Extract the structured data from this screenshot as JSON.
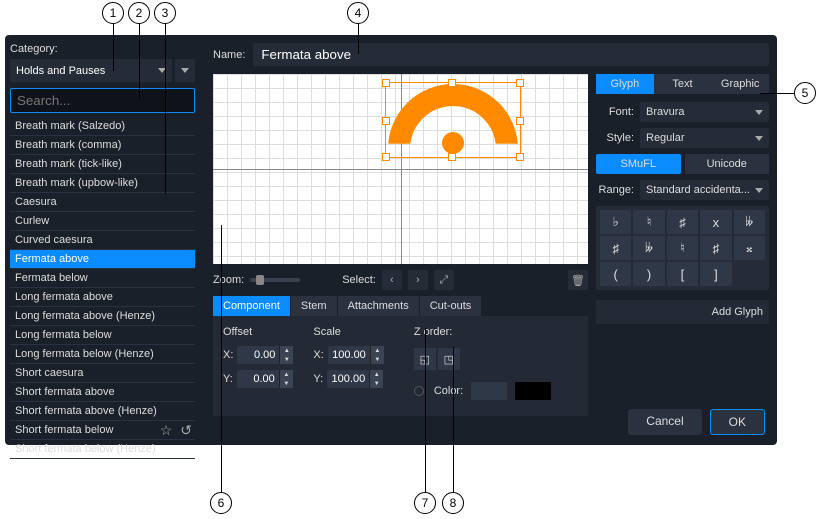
{
  "category": {
    "label": "Category:",
    "value": "Holds and Pauses"
  },
  "search": {
    "placeholder": "Search..."
  },
  "items": [
    "Breath mark (Salzedo)",
    "Breath mark (comma)",
    "Breath mark (tick-like)",
    "Breath mark (upbow-like)",
    "Caesura",
    "Curlew",
    "Curved caesura",
    "Fermata above",
    "Fermata below",
    "Long fermata above",
    "Long fermata above (Henze)",
    "Long fermata below",
    "Long fermata below (Henze)",
    "Short caesura",
    "Short fermata above",
    "Short fermata above (Henze)",
    "Short fermata below",
    "Short fermata below (Henze)"
  ],
  "selected": "Fermata above",
  "name": {
    "label": "Name:",
    "value": "Fermata above"
  },
  "zoom": {
    "label": "Zoom:"
  },
  "select": {
    "label": "Select:"
  },
  "tabs": [
    "Component",
    "Stem",
    "Attachments",
    "Cut-outs"
  ],
  "props": {
    "offset": {
      "label": "Offset",
      "x": "0.00",
      "y": "0.00"
    },
    "scale": {
      "label": "Scale",
      "x": "100.00",
      "y": "100.00"
    },
    "zorder": "Z order:",
    "color": "Color:",
    "xlabel": "X:",
    "ylabel": "Y:"
  },
  "side": {
    "tabs": [
      "Glyph",
      "Text",
      "Graphic"
    ],
    "font": {
      "label": "Font:",
      "value": "Bravura"
    },
    "style": {
      "label": "Style:",
      "value": "Regular"
    },
    "enc": [
      "SMuFL",
      "Unicode"
    ],
    "range": {
      "label": "Range:",
      "value": "Standard accidenta..."
    },
    "glyphs": [
      "♭",
      "♮",
      "♯",
      "x",
      "𝄫",
      "♯",
      "𝄫",
      "♮",
      "♯",
      "𝄪",
      "(",
      ")",
      "[",
      "]"
    ],
    "add": "Add Glyph"
  },
  "buttons": {
    "cancel": "Cancel",
    "ok": "OK"
  },
  "callouts": [
    "1",
    "2",
    "3",
    "4",
    "5",
    "6",
    "7",
    "8"
  ]
}
